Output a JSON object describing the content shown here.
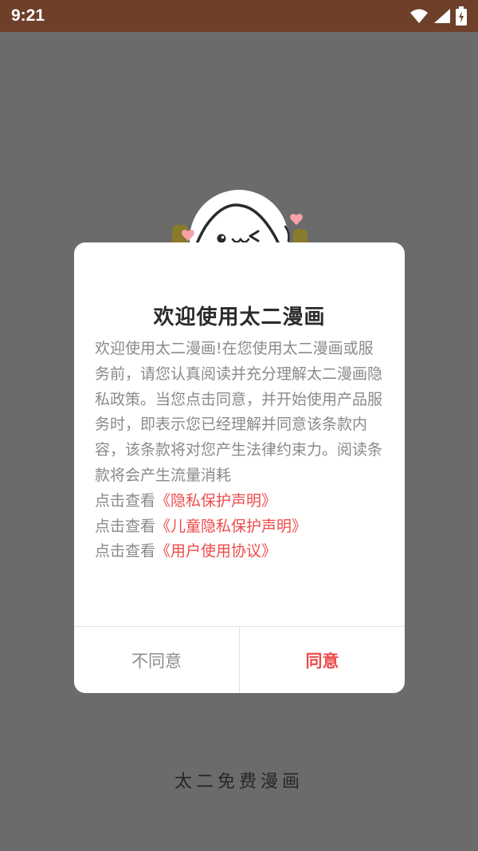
{
  "status_bar": {
    "time": "9:21",
    "icons": [
      "wifi-icon",
      "signal-icon",
      "battery-charging-icon"
    ]
  },
  "dialog": {
    "title": "欢迎使用太二漫画",
    "body": "欢迎使用太二漫画!在您使用太二漫画或服务前，请您认真阅读并充分理解太二漫画隐私政策。当您点击同意，并开始使用产品服务时，即表示您已经理解并同意该条款内容，该条款将对您产生法律约束力。阅读条款将会产生流量消耗",
    "links": [
      {
        "prefix": "点击查看",
        "label": "《隐私保护声明》"
      },
      {
        "prefix": "点击查看",
        "label": "《儿童隐私保护声明》"
      },
      {
        "prefix": "点击查看",
        "label": "《用户使用协议》"
      }
    ],
    "disagree_label": "不同意",
    "agree_label": "同意"
  },
  "brand_text": "太二免费漫画",
  "colors": {
    "status_bar": "#6e402a",
    "overlay": "#6b6b6b",
    "accent": "#ee4b4b",
    "body_text": "#8a8a8a"
  }
}
